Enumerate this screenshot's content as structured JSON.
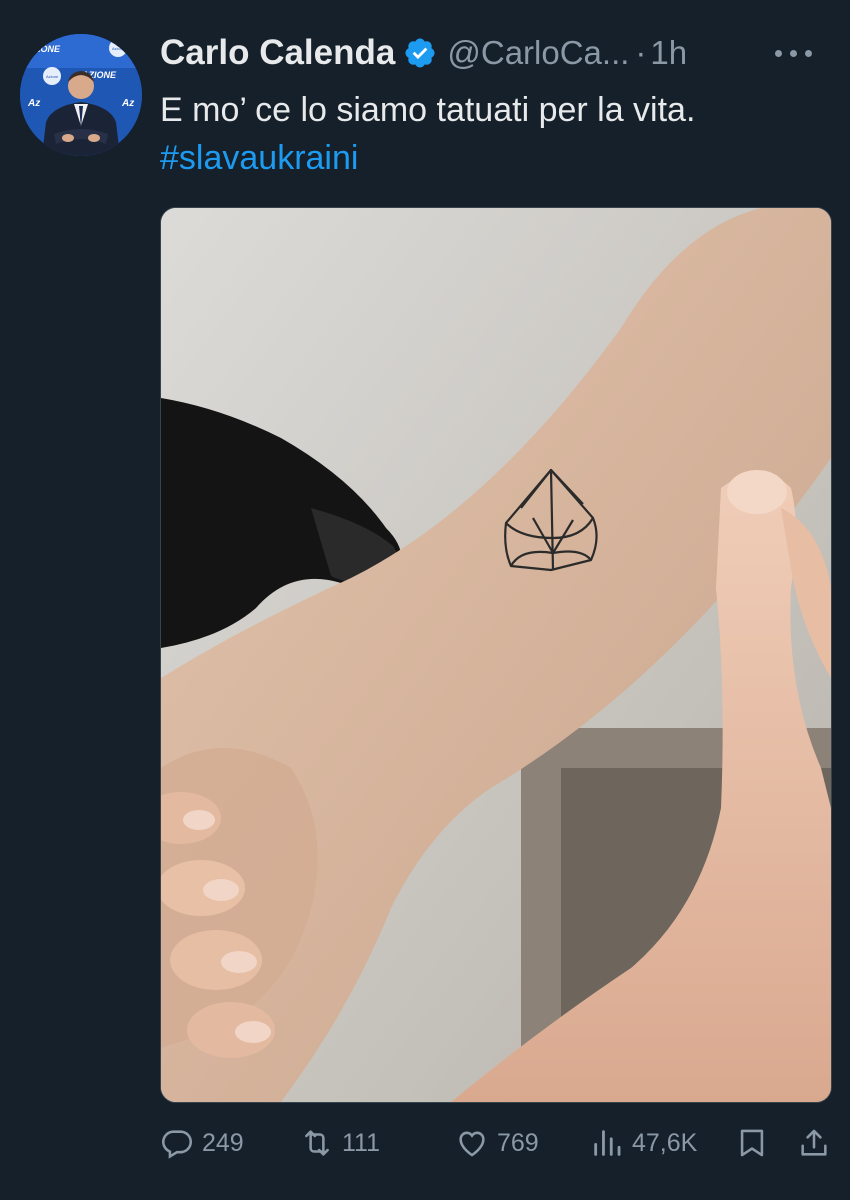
{
  "tweet": {
    "author_name": "Carlo Calenda",
    "handle": "@CarloCa...",
    "separator": "·",
    "time": "1h",
    "text": "E mo’ ce lo siamo tatuati per la vita.",
    "hashtag": "#slavaukraini",
    "avatar_text": [
      "AZIONE",
      "AZIONE",
      "Az",
      "Az",
      "Azione",
      "Azione"
    ],
    "verified_color": "#1d9bf0"
  },
  "actions": {
    "replies": "249",
    "retweets": "111",
    "likes": "769",
    "views": "47,6K"
  },
  "icons": {
    "verified": "verified-badge-icon",
    "more": "more-dots-icon",
    "reply": "reply-icon",
    "retweet": "retweet-icon",
    "like": "heart-icon",
    "views": "views-icon",
    "bookmark": "bookmark-icon",
    "share": "share-icon"
  },
  "colors": {
    "background": "#15202b",
    "text": "#e7e9ea",
    "secondary": "#8b98a5",
    "accent": "#1d9bf0"
  }
}
